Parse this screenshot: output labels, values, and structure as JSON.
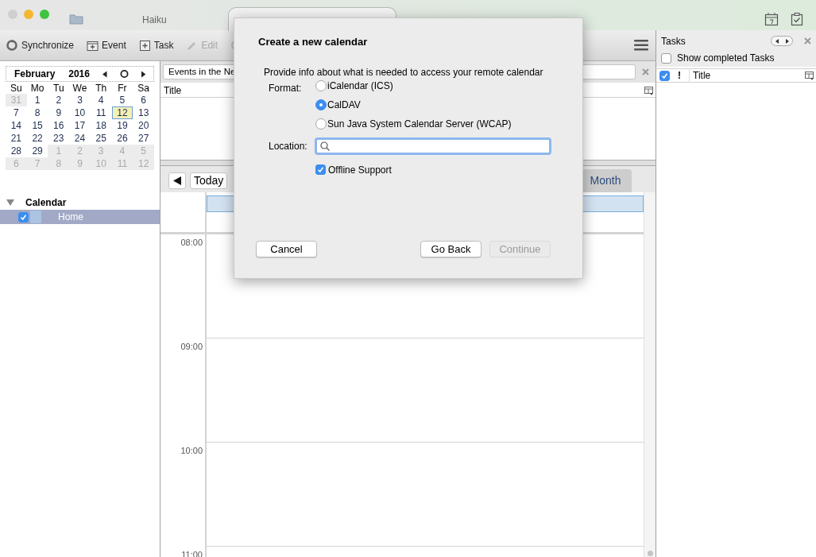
{
  "window": {
    "tab_title": "Haiku"
  },
  "toolbar": [
    {
      "kind": "sync",
      "label": "Synchronize",
      "disabled": false
    },
    {
      "kind": "event",
      "label": "Event",
      "disabled": false
    },
    {
      "kind": "task",
      "label": "Task",
      "disabled": false
    },
    {
      "kind": "edit",
      "label": "Edit",
      "disabled": true
    }
  ],
  "minimonth": {
    "month": "February",
    "year": "2016",
    "weekdays": [
      "Su",
      "Mo",
      "Tu",
      "We",
      "Th",
      "Fr",
      "Sa"
    ],
    "weeks": [
      [
        {
          "day": "31",
          "other_month": true,
          "selected": false
        },
        {
          "day": "1",
          "other_month": false,
          "selected": false
        },
        {
          "day": "2",
          "other_month": false,
          "selected": false
        },
        {
          "day": "3",
          "other_month": false,
          "selected": false
        },
        {
          "day": "4",
          "other_month": false,
          "selected": false
        },
        {
          "day": "5",
          "other_month": false,
          "selected": false
        },
        {
          "day": "6",
          "other_month": false,
          "selected": false
        }
      ],
      [
        {
          "day": "7",
          "other_month": false,
          "selected": false
        },
        {
          "day": "8",
          "other_month": false,
          "selected": false
        },
        {
          "day": "9",
          "other_month": false,
          "selected": false
        },
        {
          "day": "10",
          "other_month": false,
          "selected": false
        },
        {
          "day": "11",
          "other_month": false,
          "selected": false
        },
        {
          "day": "12",
          "other_month": false,
          "selected": true
        },
        {
          "day": "13",
          "other_month": false,
          "selected": false
        }
      ],
      [
        {
          "day": "14",
          "other_month": false,
          "selected": false
        },
        {
          "day": "15",
          "other_month": false,
          "selected": false
        },
        {
          "day": "16",
          "other_month": false,
          "selected": false
        },
        {
          "day": "17",
          "other_month": false,
          "selected": false
        },
        {
          "day": "18",
          "other_month": false,
          "selected": false
        },
        {
          "day": "19",
          "other_month": false,
          "selected": false
        },
        {
          "day": "20",
          "other_month": false,
          "selected": false
        }
      ],
      [
        {
          "day": "21",
          "other_month": false,
          "selected": false
        },
        {
          "day": "22",
          "other_month": false,
          "selected": false
        },
        {
          "day": "23",
          "other_month": false,
          "selected": false
        },
        {
          "day": "24",
          "other_month": false,
          "selected": false
        },
        {
          "day": "25",
          "other_month": false,
          "selected": false
        },
        {
          "day": "26",
          "other_month": false,
          "selected": false
        },
        {
          "day": "27",
          "other_month": false,
          "selected": false
        }
      ],
      [
        {
          "day": "28",
          "other_month": false,
          "selected": false
        },
        {
          "day": "29",
          "other_month": false,
          "selected": false
        },
        {
          "day": "1",
          "other_month": true,
          "selected": false
        },
        {
          "day": "2",
          "other_month": true,
          "selected": false
        },
        {
          "day": "3",
          "other_month": true,
          "selected": false
        },
        {
          "day": "4",
          "other_month": true,
          "selected": false
        },
        {
          "day": "5",
          "other_month": true,
          "selected": false
        }
      ],
      [
        {
          "day": "6",
          "other_month": true,
          "selected": false
        },
        {
          "day": "7",
          "other_month": true,
          "selected": false
        },
        {
          "day": "8",
          "other_month": true,
          "selected": false
        },
        {
          "day": "9",
          "other_month": true,
          "selected": false
        },
        {
          "day": "10",
          "other_month": true,
          "selected": false
        },
        {
          "day": "11",
          "other_month": true,
          "selected": false
        },
        {
          "day": "12",
          "other_month": true,
          "selected": false
        }
      ]
    ]
  },
  "calendar_list": {
    "title": "Calendar",
    "expanded": true,
    "items": [
      {
        "name": "Home",
        "checked": true,
        "selected": true,
        "color": "#aac4e2"
      }
    ]
  },
  "event_filter": {
    "value": "Events in the Ne"
  },
  "event_list": {
    "columns": [
      "Title"
    ]
  },
  "day_nav": {
    "today": "Today"
  },
  "view_tabs": [
    {
      "label": "Month",
      "selected": false
    }
  ],
  "day_view": {
    "times": [
      "08:00",
      "09:00",
      "10:00",
      "11:00"
    ]
  },
  "tasks": {
    "title": "Tasks",
    "show_completed": {
      "label": "Show completed Tasks",
      "checked": false
    },
    "columns": [
      {
        "kind": "check",
        "checked": true
      },
      {
        "kind": "priority",
        "label": "!"
      },
      {
        "kind": "text",
        "label": "Title"
      }
    ]
  },
  "dialog": {
    "title": "Create a new calendar",
    "description": "Provide info about what is needed to access your remote calendar",
    "format_label": "Format:",
    "formats": [
      {
        "label": "iCalendar (ICS)",
        "selected": false
      },
      {
        "label": "CalDAV",
        "selected": true
      },
      {
        "label": "Sun Java System Calendar Server (WCAP)",
        "selected": false
      }
    ],
    "location_label": "Location:",
    "offline_support": {
      "label": "Offline Support",
      "checked": true
    },
    "buttons": [
      {
        "label": "Cancel",
        "disabled": false
      },
      {
        "label": "Go Back",
        "disabled": false
      },
      {
        "label": "Continue",
        "disabled": true
      }
    ]
  }
}
